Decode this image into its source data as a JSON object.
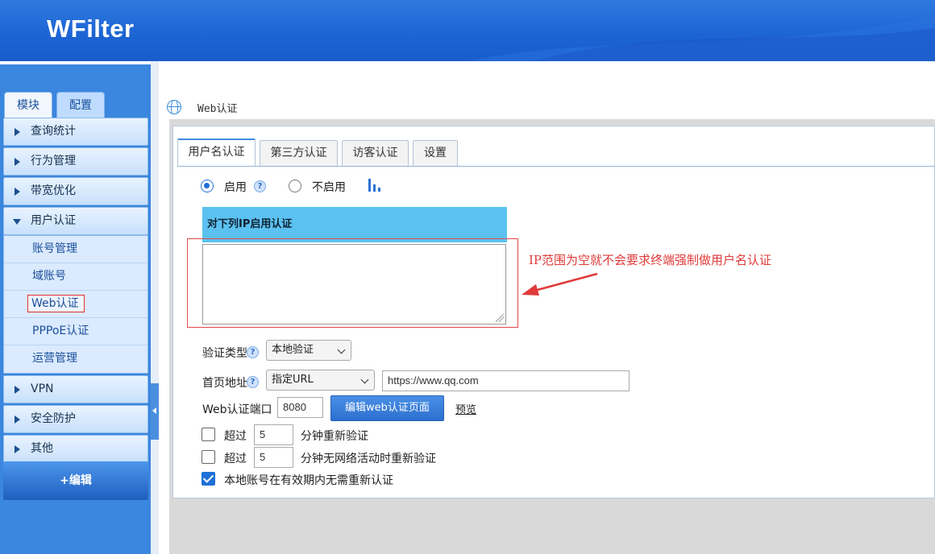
{
  "app": {
    "logo": "WFilter"
  },
  "sidebar": {
    "tabs": [
      {
        "label": "模块"
      },
      {
        "label": "配置"
      }
    ],
    "menu": [
      {
        "label": "查询统计"
      },
      {
        "label": "行为管理"
      },
      {
        "label": "带宽优化"
      },
      {
        "label": "用户认证",
        "expanded": true,
        "children": [
          {
            "label": "账号管理"
          },
          {
            "label": "域账号"
          },
          {
            "label": "Web认证",
            "active": true
          },
          {
            "label": "PPPoE认证"
          },
          {
            "label": "运营管理"
          }
        ]
      },
      {
        "label": "VPN"
      },
      {
        "label": "安全防护"
      },
      {
        "label": "其他"
      }
    ],
    "edit_button": "+编辑"
  },
  "breadcrumb": {
    "title": "Web认证",
    "icon": "globe-icon"
  },
  "tabs": [
    {
      "label": "用户名认证",
      "active": true
    },
    {
      "label": "第三方认证"
    },
    {
      "label": "访客认证"
    },
    {
      "label": "设置"
    }
  ],
  "form": {
    "enable_label": "启用",
    "disable_label": "不启用",
    "enabled": true,
    "ip_section_header": "对下列IP启用认证",
    "ip_ranges": "",
    "annotation": "IP范围为空就不会要求终端强制做用户名认证",
    "auth_type_label": "验证类型",
    "auth_type_value": "本地验证",
    "homepage_label": "首页地址",
    "homepage_type": "指定URL",
    "homepage_url": "https://www.qq.com",
    "port_label": "Web认证端口",
    "port_value": "8080",
    "edit_page_button": "编辑web认证页面",
    "preview_link": "预览",
    "timeout_prefix": "超过",
    "timeout_minutes": "5",
    "timeout_suffix": "分钟重新验证",
    "timeout_checked": false,
    "idle_prefix": "超过",
    "idle_minutes": "5",
    "idle_suffix": "分钟无网络活动时重新验证",
    "idle_checked": false,
    "local_valid_label": "本地账号在有效期内无需重新认证",
    "local_valid_checked": true,
    "help_glyph": "?"
  },
  "colors": {
    "header": "#1c63d3",
    "sidebar": "#3b86de",
    "accent": "#1e6fd6",
    "annotation": "#e03a3a",
    "ip_header": "#5bc1f0"
  }
}
